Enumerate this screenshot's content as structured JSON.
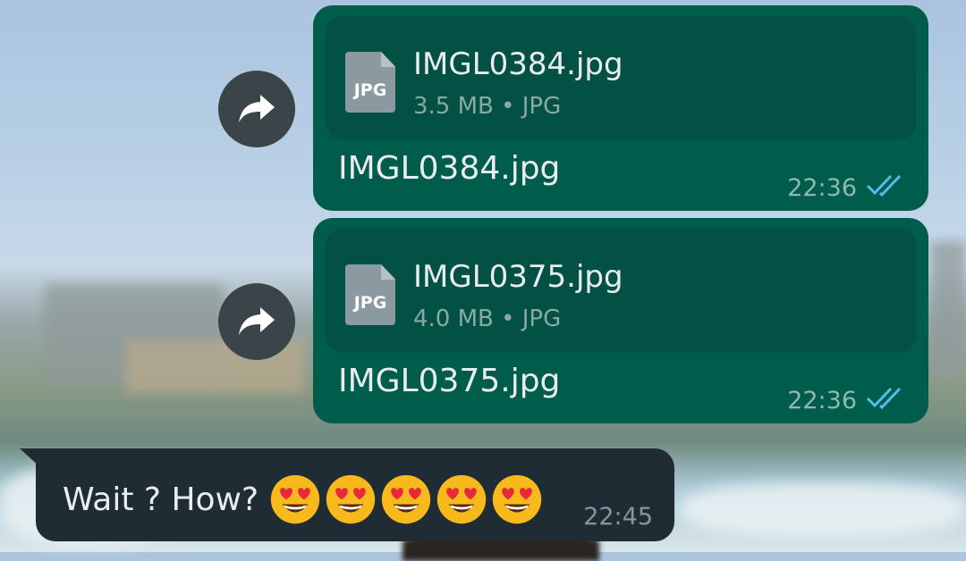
{
  "messages": [
    {
      "direction": "outgoing",
      "file": {
        "name": "IMGL0384.jpg",
        "meta": "3.5 MB • JPG",
        "icon_label": "JPG"
      },
      "caption": "IMGL0384.jpg",
      "time": "22:36",
      "status_icon": "double-check-read-icon"
    },
    {
      "direction": "outgoing",
      "file": {
        "name": "IMGL0375.jpg",
        "meta": "4.0 MB • JPG",
        "icon_label": "JPG"
      },
      "caption": "IMGL0375.jpg",
      "time": "22:36",
      "status_icon": "double-check-read-icon"
    },
    {
      "direction": "incoming",
      "text": "Wait ? How?",
      "emoji": [
        "smiling-face-with-heart-eyes",
        "smiling-face-with-heart-eyes",
        "smiling-face-with-heart-eyes",
        "smiling-face-with-heart-eyes",
        "smiling-face-with-heart-eyes"
      ],
      "time": "22:45"
    }
  ],
  "forward_icon": "forward-icon",
  "colors": {
    "outgoing_bubble": "#005c4b",
    "file_card": "#025144",
    "incoming_bubble": "#1f2c33",
    "read_ticks": "#53bdeb"
  }
}
